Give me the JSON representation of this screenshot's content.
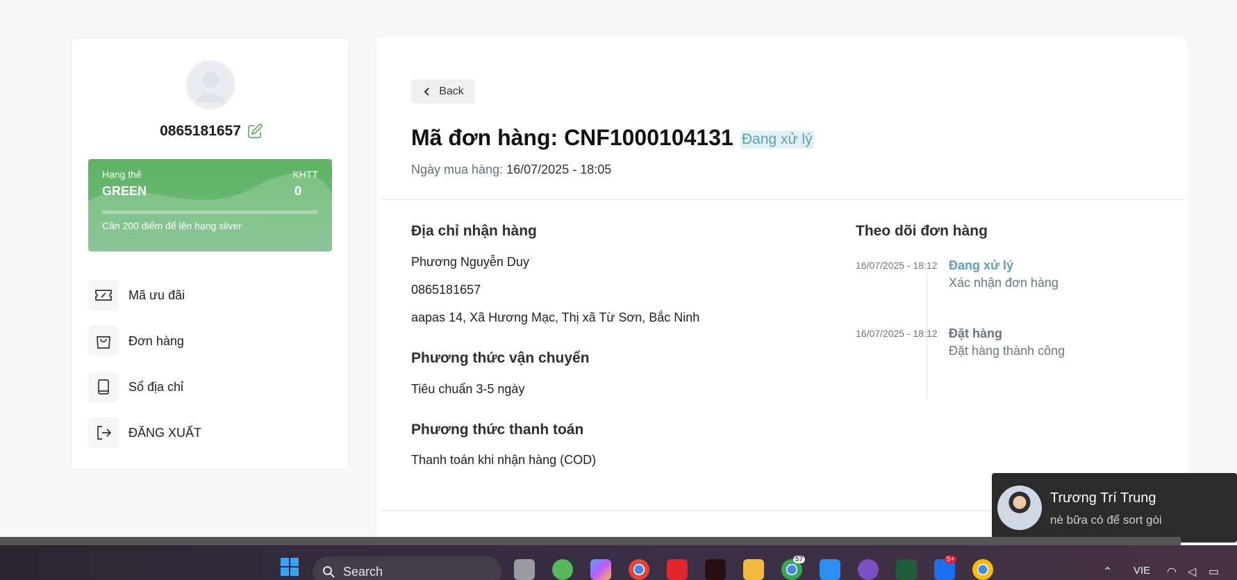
{
  "profile": {
    "phone": "0865181657",
    "rank_label": "Hạng thẻ",
    "rank_name": "GREEN",
    "khtt_label": "KHTT",
    "khtt_value": "0",
    "rank_note": "Cần 200 điểm để lên hạng silver",
    "rank_progress": 0
  },
  "menu": [
    {
      "label": "Mã ưu đãi",
      "icon": "voucher-icon"
    },
    {
      "label": "Đơn hàng",
      "icon": "shopping-bag-icon"
    },
    {
      "label": "Sổ địa chỉ",
      "icon": "address-book-icon"
    },
    {
      "label": "ĐĂNG XUẤT",
      "icon": "logout-icon"
    }
  ],
  "order": {
    "back_label": "Back",
    "title": "Mã đơn hàng: CNF1000104131",
    "status": "Đang xử lý",
    "purchase_label": "Ngày mua hàng:",
    "purchase_date": "16/07/2025 - 18:05",
    "address_title": "Địa chỉ nhận hàng",
    "recipient": "Phương Nguyễn Duy",
    "recipient_phone": "0865181657",
    "address": "aapas 14, Xã Hương Mạc, Thị xã Từ Sơn, Bắc Ninh",
    "shipping_title": "Phương thức vận chuyển",
    "shipping": "Tiêu chuẩn 3-5 ngày",
    "payment_title": "Phương thức thanh toán",
    "payment": "Thanh toán khi nhận hàng (COD)"
  },
  "tracking": {
    "title": "Theo dõi đơn hàng",
    "events": [
      {
        "time": "16/07/2025 - 18:12",
        "status": "Đang xử lý",
        "desc": "Xác nhận đơn hàng",
        "color": "#5aa3b2"
      },
      {
        "time": "16/07/2025 - 18:12",
        "status": "Đặt hàng",
        "desc": "Đặt hàng thành công",
        "color": "#6a7684"
      }
    ]
  },
  "toast": {
    "name": "Trương Trí Trung",
    "message": "nè bữa có để sort gòi"
  },
  "taskbar": {
    "search_label": "Search",
    "lang": "VIE",
    "badges": {
      "chrome": "57",
      "zalo": "5+"
    }
  },
  "colors": {
    "accent": "#5aa3b2",
    "rank_green": "#62b467"
  }
}
